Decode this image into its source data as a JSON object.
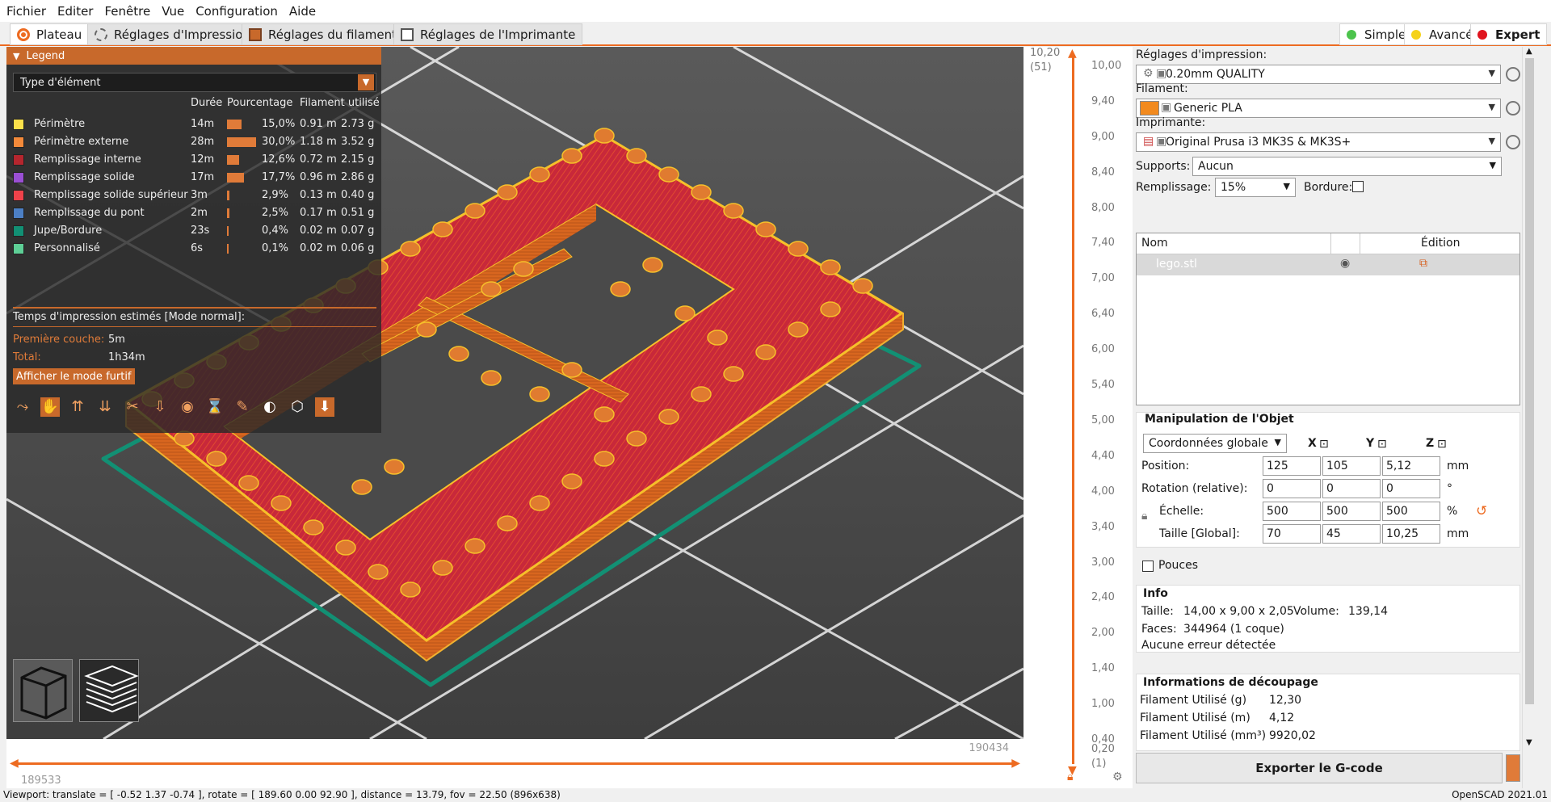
{
  "menu": [
    "Fichier",
    "Editer",
    "Fenêtre",
    "Vue",
    "Configuration",
    "Aide"
  ],
  "tabs": [
    "Plateau",
    "Réglages d'Impression",
    "Réglages du filament",
    "Réglages de l'Imprimante"
  ],
  "modes": [
    {
      "label": "Simple",
      "color": "#4cc34c"
    },
    {
      "label": "Avancé",
      "color": "#f5d21a"
    },
    {
      "label": "Expert",
      "color": "#e0141e"
    }
  ],
  "legend": {
    "title": "Legend",
    "type_select": "Type d'élément",
    "col_duration": "Durée",
    "col_percent": "Pourcentage",
    "col_filament": "Filament utilisé",
    "rows": [
      {
        "name": "Périmètre",
        "color": "#fce14a",
        "duration": "14m",
        "percent": "15,0%",
        "pct": 15.0,
        "meters": "0.91 m",
        "grams": "2.73 g"
      },
      {
        "name": "Périmètre externe",
        "color": "#f48a3a",
        "duration": "28m",
        "percent": "30,0%",
        "pct": 30.0,
        "meters": "1.18 m",
        "grams": "3.52 g"
      },
      {
        "name": "Remplissage interne",
        "color": "#b5262e",
        "duration": "12m",
        "percent": "12,6%",
        "pct": 12.6,
        "meters": "0.72 m",
        "grams": "2.15 g"
      },
      {
        "name": "Remplissage solide",
        "color": "#9a4fd4",
        "duration": "17m",
        "percent": "17,7%",
        "pct": 17.7,
        "meters": "0.96 m",
        "grams": "2.86 g"
      },
      {
        "name": "Remplissage solide supérieur",
        "color": "#f0424a",
        "duration": "3m",
        "percent": "2,9%",
        "pct": 2.9,
        "meters": "0.13 m",
        "grams": "0.40 g"
      },
      {
        "name": "Remplissage du pont",
        "color": "#4c7fc4",
        "duration": "2m",
        "percent": "2,5%",
        "pct": 2.5,
        "meters": "0.17 m",
        "grams": "0.51 g"
      },
      {
        "name": "Jupe/Bordure",
        "color": "#129074",
        "duration": "23s",
        "percent": "0,4%",
        "pct": 0.4,
        "meters": "0.02 m",
        "grams": "0.07 g"
      },
      {
        "name": "Personnalisé",
        "color": "#5ecf96",
        "duration": "6s",
        "percent": "0,1%",
        "pct": 0.1,
        "meters": "0.02 m",
        "grams": "0.06 g"
      }
    ],
    "estimated_label": "Temps d'impression estimés [Mode normal]:",
    "first_layer_label": "Première couche:",
    "first_layer_value": "5m",
    "total_label": "Total:",
    "total_value": "1h34m",
    "stealth_button": "Afficher le mode furtif"
  },
  "vslider": {
    "top_value": "10,20",
    "top_layer": "(51)",
    "bottom_value": "0,20",
    "bottom_layer": "(1)",
    "ticks": [
      "10,00",
      "9,40",
      "9,00",
      "8,40",
      "8,00",
      "7,40",
      "7,00",
      "6,40",
      "6,00",
      "5,40",
      "5,00",
      "4,40",
      "4,00",
      "3,40",
      "3,00",
      "2,40",
      "2,00",
      "1,40",
      "1,00",
      "0,40"
    ]
  },
  "hslider": {
    "right_value": "190434",
    "left_value": "189533"
  },
  "right": {
    "print_settings_label": "Réglages d'impression:",
    "print_settings_value": "0.20mm QUALITY",
    "filament_label": "Filament:",
    "filament_value": "Generic PLA",
    "filament_color": "#f28a1e",
    "printer_label": "Imprimante:",
    "printer_value": "Original Prusa i3 MK3S & MK3S+",
    "supports_label": "Supports:",
    "supports_value": "Aucun",
    "infill_label": "Remplissage:",
    "infill_value": "15%",
    "brim_label": "Bordure:",
    "list_col_name": "Nom",
    "list_col_edit": "Édition",
    "object_name": "lego.stl"
  },
  "manip": {
    "title": "Manipulation de l'Objet",
    "coords": "Coordonnées globale",
    "x": "X",
    "y": "Y",
    "z": "Z",
    "position_label": "Position:",
    "position": [
      "125",
      "105",
      "5,12"
    ],
    "position_unit": "mm",
    "rotation_label": "Rotation (relative):",
    "rotation": [
      "0",
      "0",
      "0"
    ],
    "rotation_unit": "°",
    "scale_label": "Échelle:",
    "scale": [
      "500",
      "500",
      "500"
    ],
    "scale_unit": "%",
    "size_label": "Taille [Global]:",
    "size": [
      "70",
      "45",
      "10,25"
    ],
    "size_unit": "mm",
    "inches_label": "Pouces"
  },
  "info": {
    "title": "Info",
    "size_label": "Taille:",
    "size_value": "14,00 x 9,00 x 2,05",
    "volume_label": "Volume:",
    "volume_value": "139,14",
    "faces_label": "Faces:",
    "faces_value": "344964 (1 coque)",
    "errors": "Aucune erreur détectée"
  },
  "slicing": {
    "title": "Informations de découpage",
    "rows": [
      {
        "label": "Filament Utilisé (g)",
        "value": "12,30"
      },
      {
        "label": "Filament Utilisé (m)",
        "value": "4,12"
      },
      {
        "label": "Filament Utilisé (mm³)",
        "value": "9920,02"
      }
    ]
  },
  "export_button": "Exporter le G-code",
  "status": {
    "left": "Viewport: translate = [ -0.52 1.37 -0.74 ], rotate = [ 189.60 0.00 92.90 ], distance = 13.79, fov = 22.50 (896x638)",
    "right": "OpenSCAD 2021.01"
  }
}
